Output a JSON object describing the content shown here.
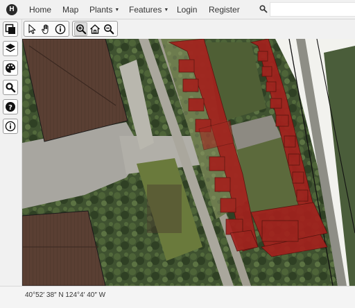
{
  "nav": {
    "brand_letter": "H",
    "home": "Home",
    "map": "Map",
    "plants": "Plants",
    "features": "Features",
    "login": "Login",
    "register": "Register",
    "search_placeholder": ""
  },
  "left_toolbar": {
    "items": [
      "base-layer-toggle",
      "layers-icon",
      "palette-icon",
      "search-icon",
      "help-icon",
      "info-icon"
    ]
  },
  "map_toolbar": {
    "items": [
      "select-arrow-icon",
      "pan-hand-icon",
      "identify-icon",
      "zoom-in-icon",
      "home-extent-icon",
      "zoom-out-icon"
    ],
    "active": "zoom-in-icon"
  },
  "status": {
    "coordinates": "40°52′ 38″ N 124°4′ 40″ W"
  },
  "colors": {
    "chrome_bg": "#f1f1f1",
    "building_overlay": "#a3211d",
    "foliage": "#3f5230",
    "roof": "#5a3f33",
    "pavement": "#a8a6a0"
  }
}
